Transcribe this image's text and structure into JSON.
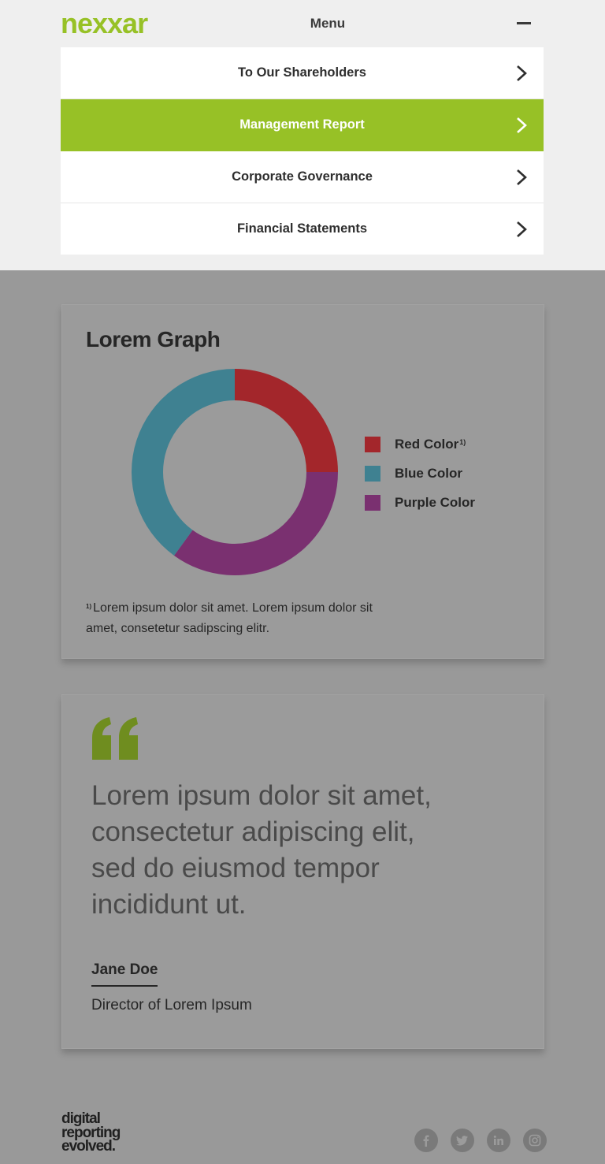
{
  "header": {
    "logo_text": "nexxar",
    "menu_label": "Menu",
    "close_icon": "minus-icon",
    "brand_color": "#97c126"
  },
  "menu": {
    "items": [
      {
        "label": "To Our Shareholders",
        "active": false,
        "icon": "chevron-right-icon"
      },
      {
        "label": "Management Report",
        "active": true,
        "icon": "chevron-right-icon"
      },
      {
        "label": "Corporate Governance",
        "active": false,
        "icon": "chevron-right-icon"
      },
      {
        "label": "Financial Statements",
        "active": false,
        "icon": "chevron-right-icon"
      }
    ]
  },
  "graph_card": {
    "title": "Lorem Graph",
    "legend": [
      {
        "label": "Red Color",
        "sup": "1)",
        "color": "#a3262b"
      },
      {
        "label": "Blue Color",
        "sup": "",
        "color": "#3f8191"
      },
      {
        "label": "Purple Color",
        "sup": "",
        "color": "#7a3070"
      }
    ],
    "footnote_sup": "1)",
    "footnote": "Lorem ipsum dolor sit amet. Lorem ipsum dolor sit amet, consetetur sadipscing elitr."
  },
  "chart_data": {
    "type": "pie",
    "donut": true,
    "title": "Lorem Graph",
    "series": [
      {
        "name": "Red Color",
        "value": 25,
        "color": "#a3262b"
      },
      {
        "name": "Purple Color",
        "value": 35,
        "color": "#7a3070"
      },
      {
        "name": "Blue Color",
        "value": 40,
        "color": "#3f8191"
      }
    ],
    "legend_position": "right"
  },
  "quote_card": {
    "quote_icon": "quote-icon",
    "quote": "Lorem ipsum dolor sit amet, consectetur adipiscing elit, sed do eiusmod tempor incididunt ut.",
    "author": "Jane Doe",
    "role": "Director of Lorem Ipsum",
    "accent": "#6f8d1f"
  },
  "footer": {
    "brand_line1": "digital",
    "brand_line2": "reporting",
    "brand_line3": "evolved.",
    "socials": [
      "facebook-icon",
      "twitter-icon",
      "linkedin-icon",
      "instagram-icon"
    ]
  }
}
